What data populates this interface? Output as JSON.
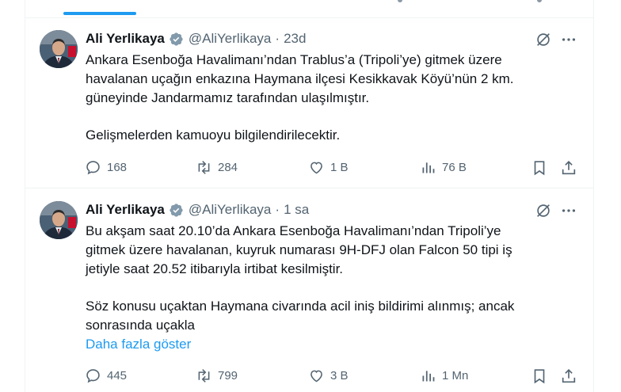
{
  "colors": {
    "accent": "#1d9bf0",
    "muted": "#536471",
    "text": "#0f1419",
    "divider": "#eff3f4"
  },
  "tweets": [
    {
      "author_name": "Ali Yerlikaya",
      "handle": "@AliYerlikaya",
      "separator": "·",
      "time": "23d",
      "paragraphs": [
        [
          "Ankara Esenboğa Havalimanı’ndan Trablus’a (Tripoli’ye) gitmek üzere",
          "havalanan uçağın enkazına Haymana ilçesi Kesikkavak Köyü’nün 2 km.",
          "güneyinde Jandarmamız tarafından ulaşılmıştır."
        ],
        [
          "Gelişmelerden kamuoyu bilgilendirilecektir."
        ]
      ],
      "show_more": "",
      "replies": "168",
      "reposts": "284",
      "likes": "1 B",
      "views": "76 B"
    },
    {
      "author_name": "Ali Yerlikaya",
      "handle": "@AliYerlikaya",
      "separator": "·",
      "time": "1 sa",
      "paragraphs": [
        [
          "Bu akşam saat 20.10’da Ankara Esenboğa Havalimanı’ndan Tripoli’ye",
          "gitmek üzere havalanan, kuyruk numarası 9H-DFJ olan Falcon 50 tipi iş",
          "jetiyle saat 20.52 itibarıyla irtibat kesilmiştir."
        ],
        [
          "Söz konusu uçaktan Haymana civarında acil iniş bildirimi alınmış; ancak",
          "sonrasında uçakla"
        ]
      ],
      "show_more": "Daha fazla göster",
      "replies": "445",
      "reposts": "799",
      "likes": "3 B",
      "views": "1 Mn"
    }
  ],
  "icons": [
    "verified-badge-icon",
    "grok-icon",
    "more-icon",
    "reply-icon",
    "repost-icon",
    "like-icon",
    "views-icon",
    "bookmark-icon",
    "share-icon"
  ]
}
